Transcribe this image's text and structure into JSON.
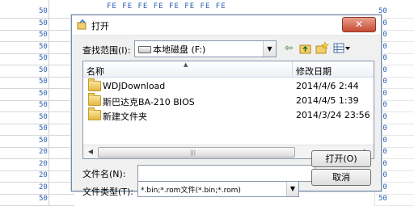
{
  "background": {
    "left_row_labels": [
      "50",
      "50",
      "50",
      "50",
      "50",
      "50",
      "50",
      "50",
      "50",
      "50",
      "50",
      "50",
      "20",
      "20",
      "20",
      "20",
      "50"
    ],
    "top_text": "FE  FE  FE  FE  FE  FE  FE  FE"
  },
  "dialog": {
    "title": "打开",
    "close_glyph": "✕",
    "look_in_label": "查找范围(I):",
    "look_in_value": "本地磁盘 (F:)",
    "columns": {
      "name": "名称",
      "date": "修改日期"
    },
    "files": [
      {
        "name": "WDJDownload",
        "date": "2014/4/6 2:44"
      },
      {
        "name": "斯巴达克BA-210 BIOS",
        "date": "2014/4/5 1:39"
      },
      {
        "name": "新建文件夹",
        "date": "2014/3/24 23:56"
      }
    ],
    "file_name_label": "文件名(N):",
    "file_name_value": "",
    "file_type_label": "文件类型(T):",
    "file_type_value": "*.bin;*.rom文件(*.bin;*.rom)",
    "open_button": "打开(O)",
    "cancel_button": "取消",
    "icons": {
      "back": "⇦",
      "up": "up-folder-icon",
      "new_folder": "new-folder-icon",
      "view": "view-menu-icon"
    }
  }
}
